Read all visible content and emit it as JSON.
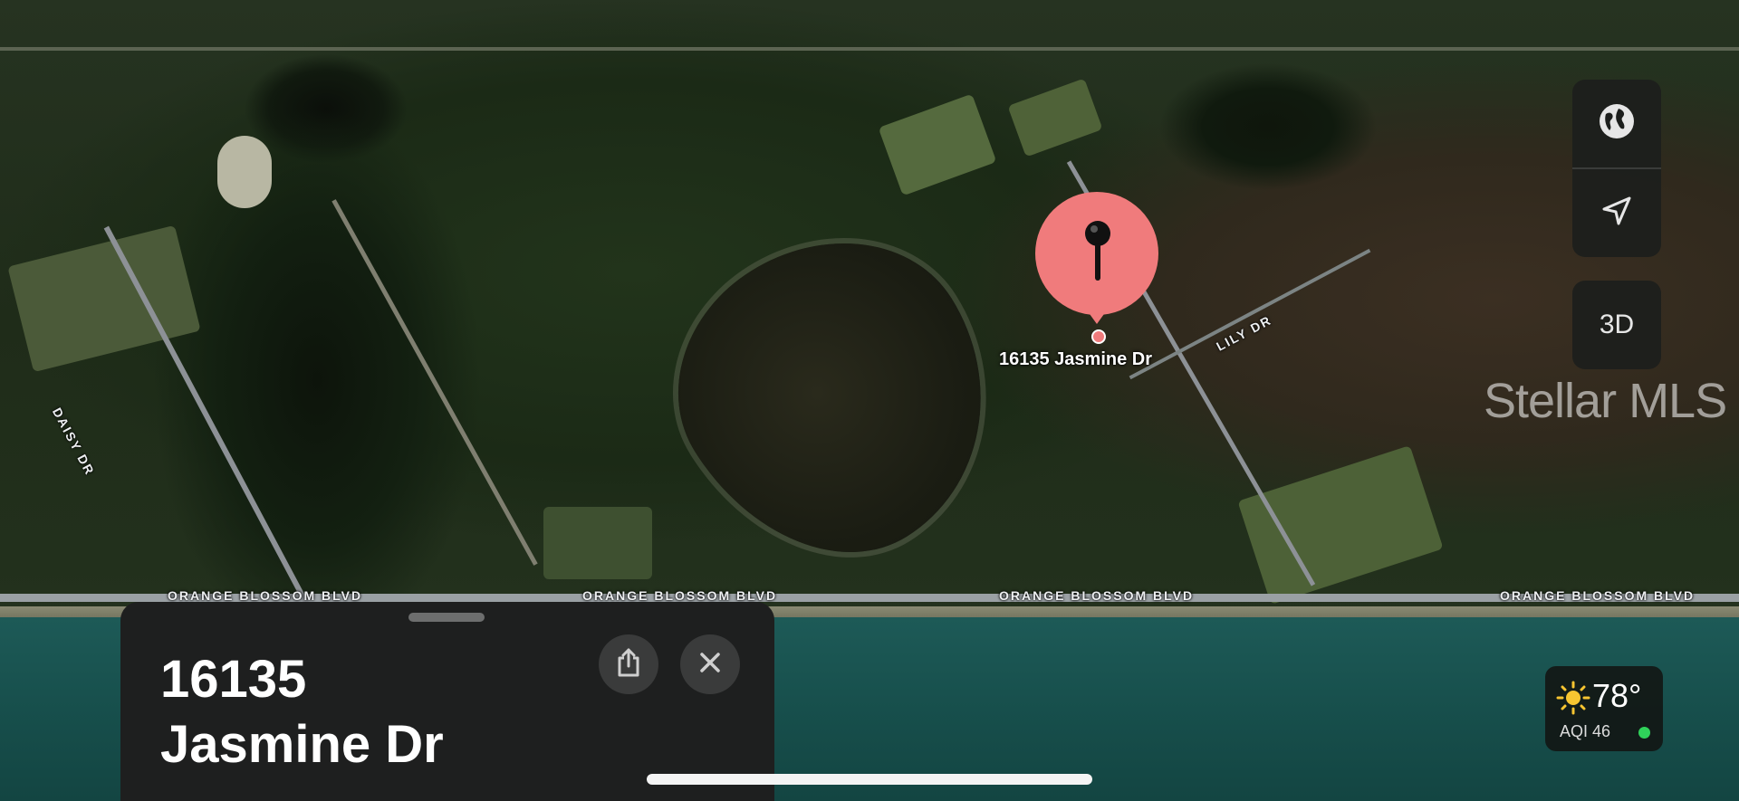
{
  "map": {
    "pin_address": "16135 Jasmine Dr",
    "watermark": "Stellar MLS",
    "road_labels": {
      "orange_blossom": "ORANGE BLOSSOM BLVD",
      "lily": "LILY DR",
      "daisy": "DAISY DR"
    }
  },
  "controls": {
    "globe_icon": "globe-icon",
    "location_icon": "location-arrow-icon",
    "view_3d_label": "3D"
  },
  "weather": {
    "icon": "sun-icon",
    "temperature": "78°",
    "aqi": "AQI 46",
    "aqi_color": "#2fd25a"
  },
  "sheet": {
    "title_line1": "16135",
    "title_line2": "Jasmine Dr",
    "share_icon": "share-icon",
    "close_icon": "close-icon"
  },
  "colors": {
    "pin": "#f07b7c",
    "sheet_background": "#1e1f1f"
  }
}
